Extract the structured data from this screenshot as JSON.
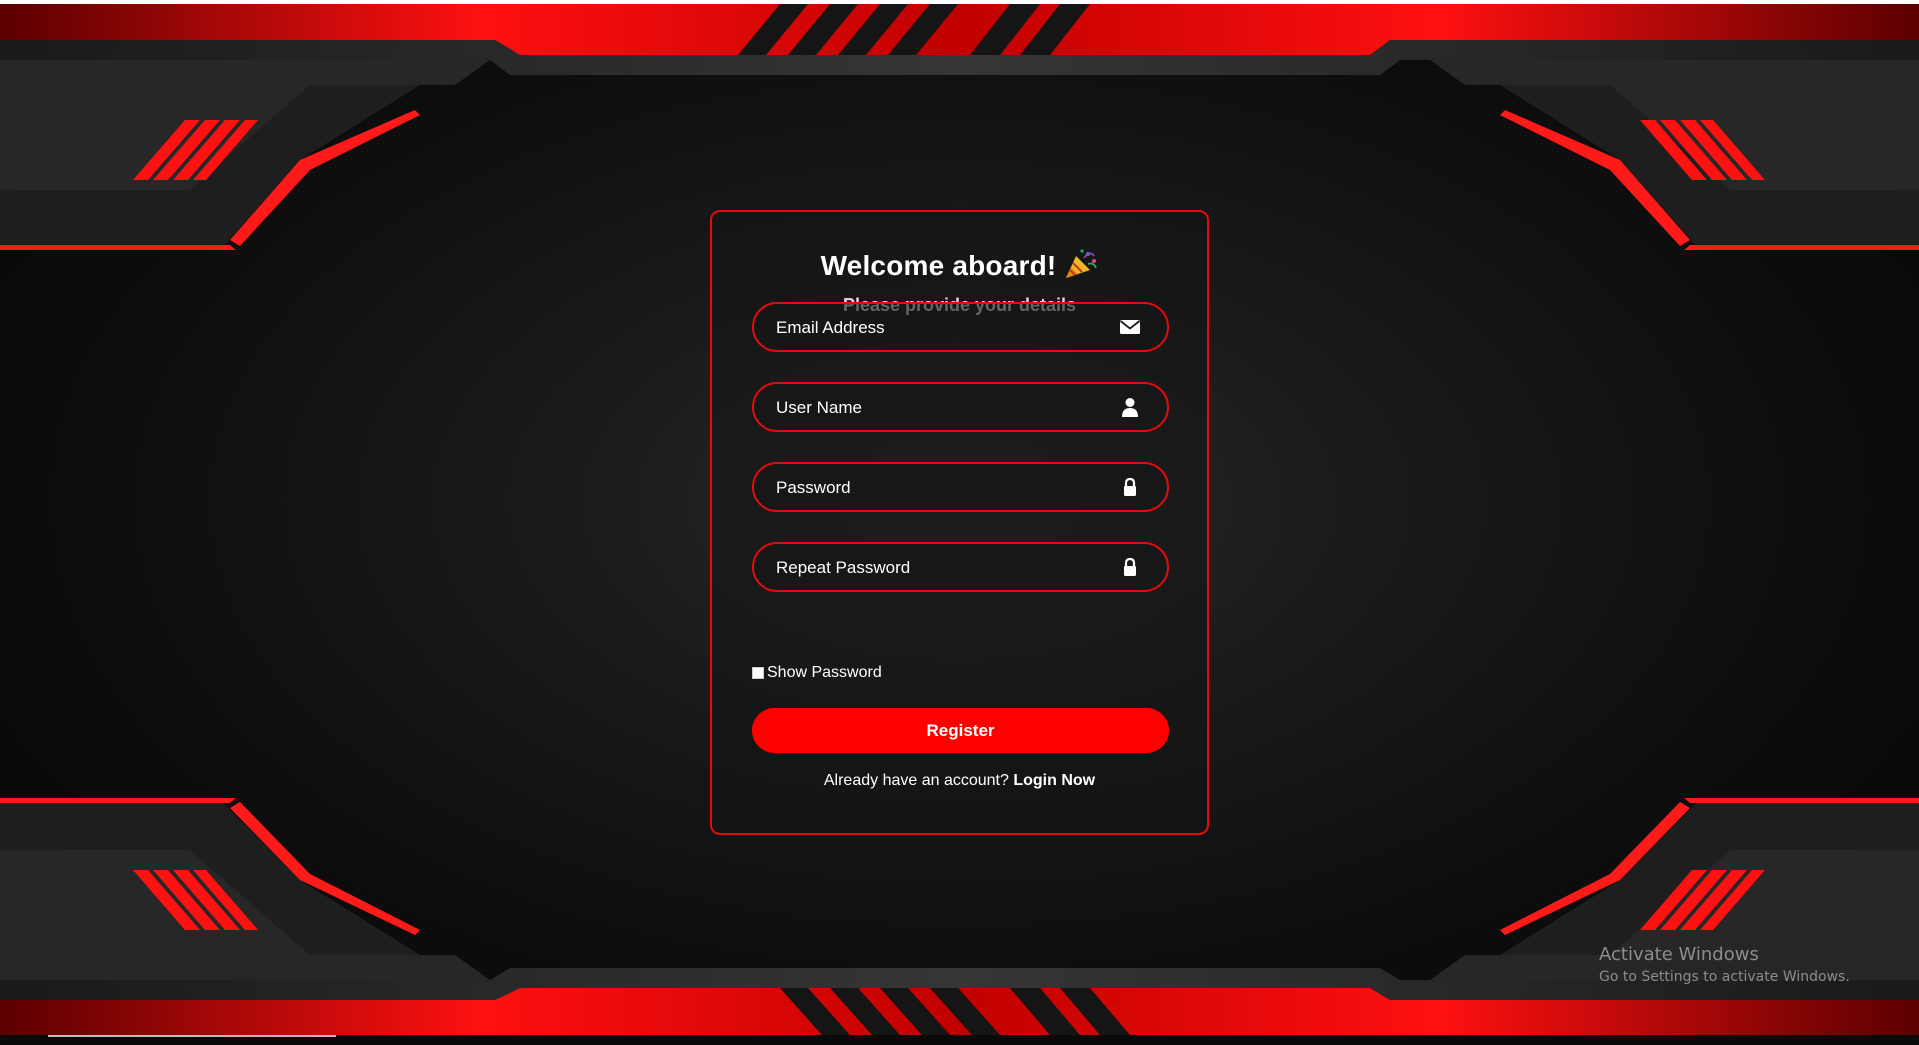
{
  "form": {
    "title": "Welcome aboard!",
    "title_emoji": "party-popper-icon",
    "subtitle": "Please provide your details",
    "fields": [
      {
        "placeholder": "Email Address",
        "type": "email",
        "icon": "envelope-icon"
      },
      {
        "placeholder": "User Name",
        "type": "text",
        "icon": "user-icon"
      },
      {
        "placeholder": "Password",
        "type": "password",
        "icon": "lock-icon"
      },
      {
        "placeholder": "Repeat Password",
        "type": "password",
        "icon": "lock-icon"
      }
    ],
    "show_password_label": "Show Password",
    "show_password_checked": false,
    "register_label": "Register",
    "login_prompt": "Already have an account?",
    "login_link": "Login Now"
  },
  "watermark": {
    "line1": "Activate Windows",
    "line2": "Go to Settings to activate Windows."
  },
  "colors": {
    "accent": "#ff0000",
    "border": "#e10d0d",
    "background": "#111111",
    "text": "#ffffff"
  }
}
